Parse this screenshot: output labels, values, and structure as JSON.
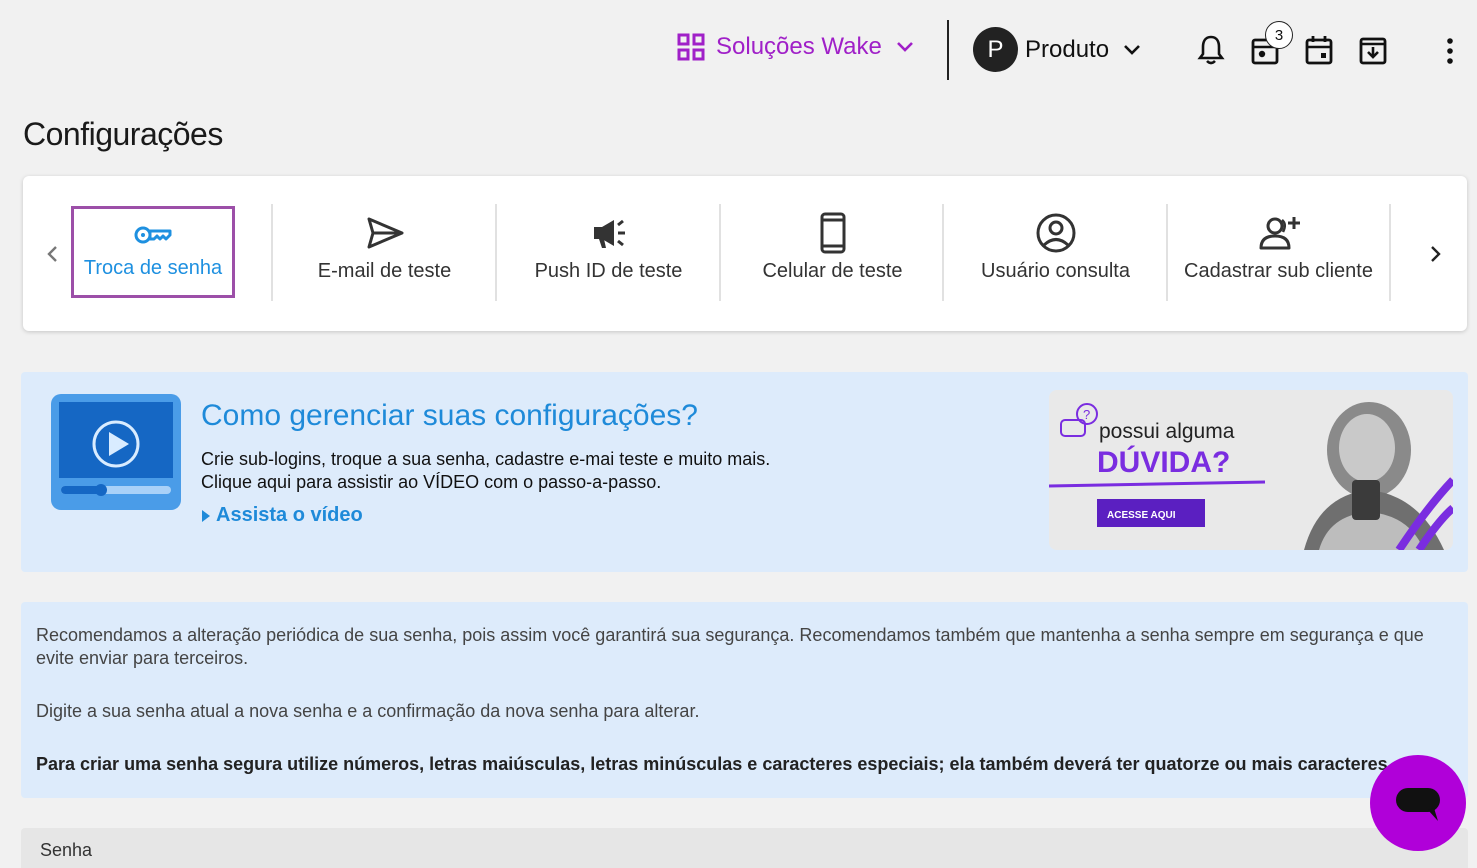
{
  "header": {
    "solutions_label": "Soluções Wake",
    "user_initial": "P",
    "user_name": "Produto",
    "tasks_badge": "3",
    "accent_color": "#a020c8"
  },
  "page_title": "Configurações",
  "tabs": [
    {
      "label": "Troca de senha",
      "icon": "key-icon",
      "active": true
    },
    {
      "label": "E-mail de teste",
      "icon": "send-icon",
      "active": false
    },
    {
      "label": "Push ID de teste",
      "icon": "megaphone-icon",
      "active": false
    },
    {
      "label": "Celular de teste",
      "icon": "phone-icon",
      "active": false
    },
    {
      "label": "Usuário consulta",
      "icon": "user-circle-icon",
      "active": false
    },
    {
      "label": "Cadastrar sub cliente",
      "icon": "add-user-icon",
      "active": false
    }
  ],
  "video_banner": {
    "title": "Como gerenciar suas configurações?",
    "line1": "Crie sub-logins, troque a sua senha, cadastre e-mai teste e muito mais.",
    "line2": "Clique aqui para assistir ao VÍDEO com o passo-a-passo.",
    "link": "Assista o vídeo"
  },
  "promo": {
    "line1": "possui alguma",
    "line2": "DÚVIDA?",
    "button": "ACESSE AQUI"
  },
  "info": {
    "p1": "Recomendamos a alteração periódica de sua senha, pois assim você garantirá sua segurança. Recomendamos também que mantenha a senha sempre em segurança e que evite enviar para terceiros.",
    "p2": "Digite a sua senha atual a nova senha e a confirmação da nova senha para alterar.",
    "p3": "Para criar uma senha segura utilize números, letras maiúsculas, letras minúsculas e caracteres especiais; ela também deverá ter quatorze ou mais caracteres."
  },
  "form": {
    "senha_label": "Senha"
  }
}
